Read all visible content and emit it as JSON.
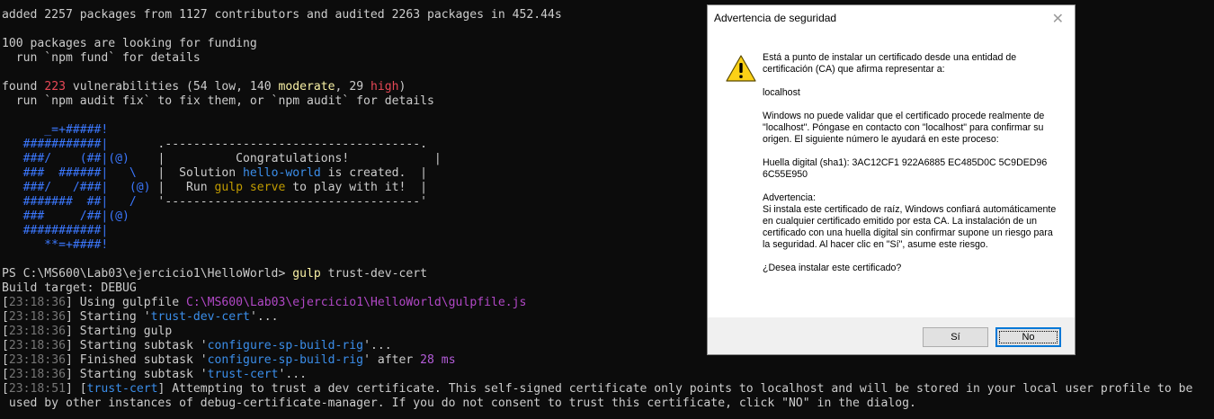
{
  "terminal": {
    "lines": {
      "l0": "added 2257 packages from 1127 contributors and audited 2263 packages in 452.44s",
      "l2": "100 packages are looking for funding",
      "l3": "  run `npm fund` for details",
      "l5a": "found ",
      "l5b": "223",
      "l5c": " vulnerabilities (54 low, 140 ",
      "l5d": "moderate",
      "l5e": ", 29 ",
      "l5f": "high",
      "l5g": ")",
      "l6": "  run `npm audit fix` to fix them, or `npm audit` for details",
      "a1": "      _=+#####!",
      "a2a": "   ###########|",
      "a2b": "       .------------------------------------.",
      "a3a": "   ###/    (##|(@)",
      "a3b": "    |          Congratulations!            |",
      "a4a": "   ###  ######|   \\",
      "a4b": "   |  Solution ",
      "a4c": "hello-world",
      "a4d": " is created.  |",
      "a5a": "   ###/   /###|   (@)",
      "a5b": " |   Run ",
      "a5c": "gulp serve",
      "a5d": " to play with it!  |",
      "a6a": "   #######  ##|   /",
      "a6b": "   '------------------------------------'",
      "a7a": "   ###     /##|(@)",
      "a8a": "   ###########|",
      "a9a": "      **=+####!",
      "p1": "PS C:\\MS600\\Lab03\\ejercicio1\\HelloWorld> ",
      "p1b": "gulp",
      "p1c": " trust-dev-cert",
      "p2": "Build target: DEBUG",
      "t1": "23:18:36",
      "t2": "23:18:51",
      "g1a": " Using gulpfile ",
      "g1b": "C:\\MS600\\Lab03\\ejercicio1\\HelloWorld\\gulpfile.js",
      "g2a": " Starting '",
      "g2b": "trust-dev-cert",
      "g2c": "'...",
      "g3": " Starting gulp",
      "g4a": " Starting subtask '",
      "g4b": "configure-sp-build-rig",
      "g4c": "'...",
      "g5a": " Finished subtask '",
      "g5b": "configure-sp-build-rig",
      "g5c": "' after ",
      "g5d": "28 ms",
      "g6a": " Starting subtask '",
      "g6b": "trust-cert",
      "g6c": "'...",
      "g7a": " [",
      "g7b": "trust-cert",
      "g7c": "] Attempting to trust a dev certificate. This self-signed certificate only points to localhost and will be stored in your local user profile to be",
      "g8": " used by other instances of debug-certificate-manager. If you do not consent to trust this certificate, click \"NO\" in the dialog.",
      "lb": "[",
      "rb": "]"
    }
  },
  "dialog": {
    "title": "Advertencia de seguridad",
    "close": "✕",
    "p1": "Está a punto de instalar un certificado desde una entidad de certificación (CA) que afirma representar a:",
    "p2": "localhost",
    "p3": "Windows no puede validar que el certificado procede realmente de \"localhost\". Póngase en contacto con \"localhost\" para confirmar su origen. El siguiente número le ayudará en este proceso:",
    "p4": "Huella digital (sha1): 3AC12CF1 922A6885 EC485D0C 5C9DED96 6C55E950",
    "p5a": "Advertencia:",
    "p5b": "Si instala este certificado de raíz, Windows confiará automáticamente en cualquier certificado emitido por esta CA. La instalación de un certificado con una huella digital sin confirmar supone un riesgo para la seguridad. Al hacer clic en \"Sí\", asume este riesgo.",
    "p6": "¿Desea instalar este certificado?",
    "yes_label": "Sí",
    "no_label": "No",
    "icon": "warning-icon"
  }
}
